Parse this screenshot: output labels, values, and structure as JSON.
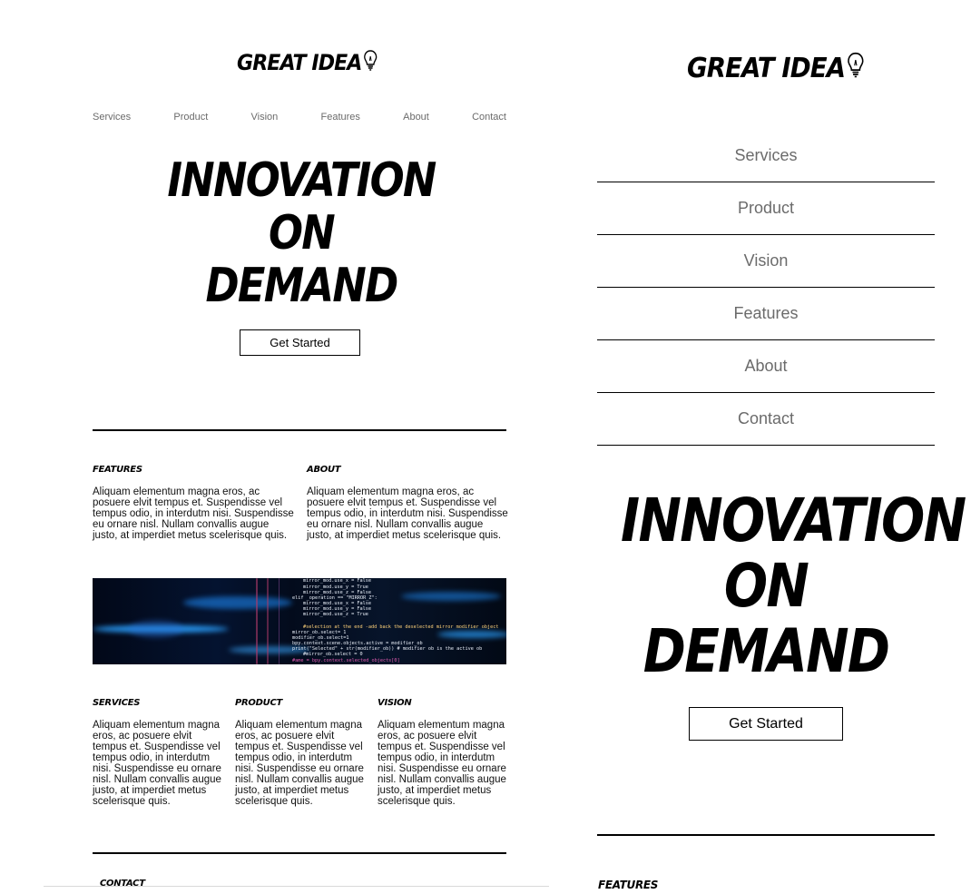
{
  "brand": {
    "logo_text": "GREAT IDEA",
    "bulb_icon": "lightbulb-icon"
  },
  "nav": [
    "Services",
    "Product",
    "Vision",
    "Features",
    "About",
    "Contact"
  ],
  "hero": {
    "title_lines": [
      "INNOVATION",
      "ON",
      "DEMAND"
    ],
    "cta_label": "Get Started"
  },
  "sections": {
    "features": {
      "title": "FEATURES",
      "text": "Aliquam elementum magna eros, ac posuere elvit tempus et. Suspendisse vel tempus odio, in interdutm nisi. Suspendisse eu ornare nisl. Nullam convallis augue justo, at imperdiet metus scelerisque quis."
    },
    "about": {
      "title": "ABOUT",
      "text": "Aliquam elementum magna eros, ac posuere elvit tempus et. Suspendisse vel tempus odio, in interdutm nisi. Suspendisse eu ornare nisl. Nullam convallis augue justo, at imperdiet metus scelerisque quis."
    },
    "services": {
      "title": "SERVICES",
      "text": "Aliquam elementum magna eros, ac posuere elvit tempus et. Suspendisse vel tempus odio, in interdutm nisi. Suspendisse eu ornare nisl. Nullam convallis augue justo, at imperdiet metus scelerisque quis."
    },
    "product": {
      "title": "PRODUCT",
      "text": "Aliquam elementum magna eros, ac posuere elvit tempus et. Suspendisse vel tempus odio, in interdutm nisi. Suspendisse eu ornare nisl. Nullam convallis augue justo, at imperdiet metus scelerisque quis."
    },
    "vision": {
      "title": "VISION",
      "text": "Aliquam elementum magna eros, ac posuere elvit tempus et. Suspendisse vel tempus odio, in interdutm nisi. Suspendisse eu ornare nisl. Nullam convallis augue justo, at imperdiet metus scelerisque quis."
    },
    "contact": {
      "title": "CONTACT"
    }
  },
  "code_image": {
    "lines": [
      "mirror_mod.use_x = False",
      "mirror_mod.use_y = True",
      "mirror_mod.use_z = False",
      "elif _operation == \"MIRROR_Z\":",
      "mirror_mod.use_x = False",
      "mirror_mod.use_y = False",
      "mirror_mod.use_z = True",
      "#selection at the end -add back the deselected mirror modifier object",
      "mirror_ob.select= 1",
      "modifier_ob.select=1",
      "bpy.context.scene.objects.active = modifier_ob",
      "print(\"Selected\" + str(modifier_ob)) # modifier ob is the active ob",
      "#mirror_ob.select = 0",
      "#ame = bpy.context.selected_objects[0]"
    ]
  },
  "colors": {
    "nav_text": "#6b6b6b",
    "text": "#000000",
    "background": "#ffffff"
  }
}
